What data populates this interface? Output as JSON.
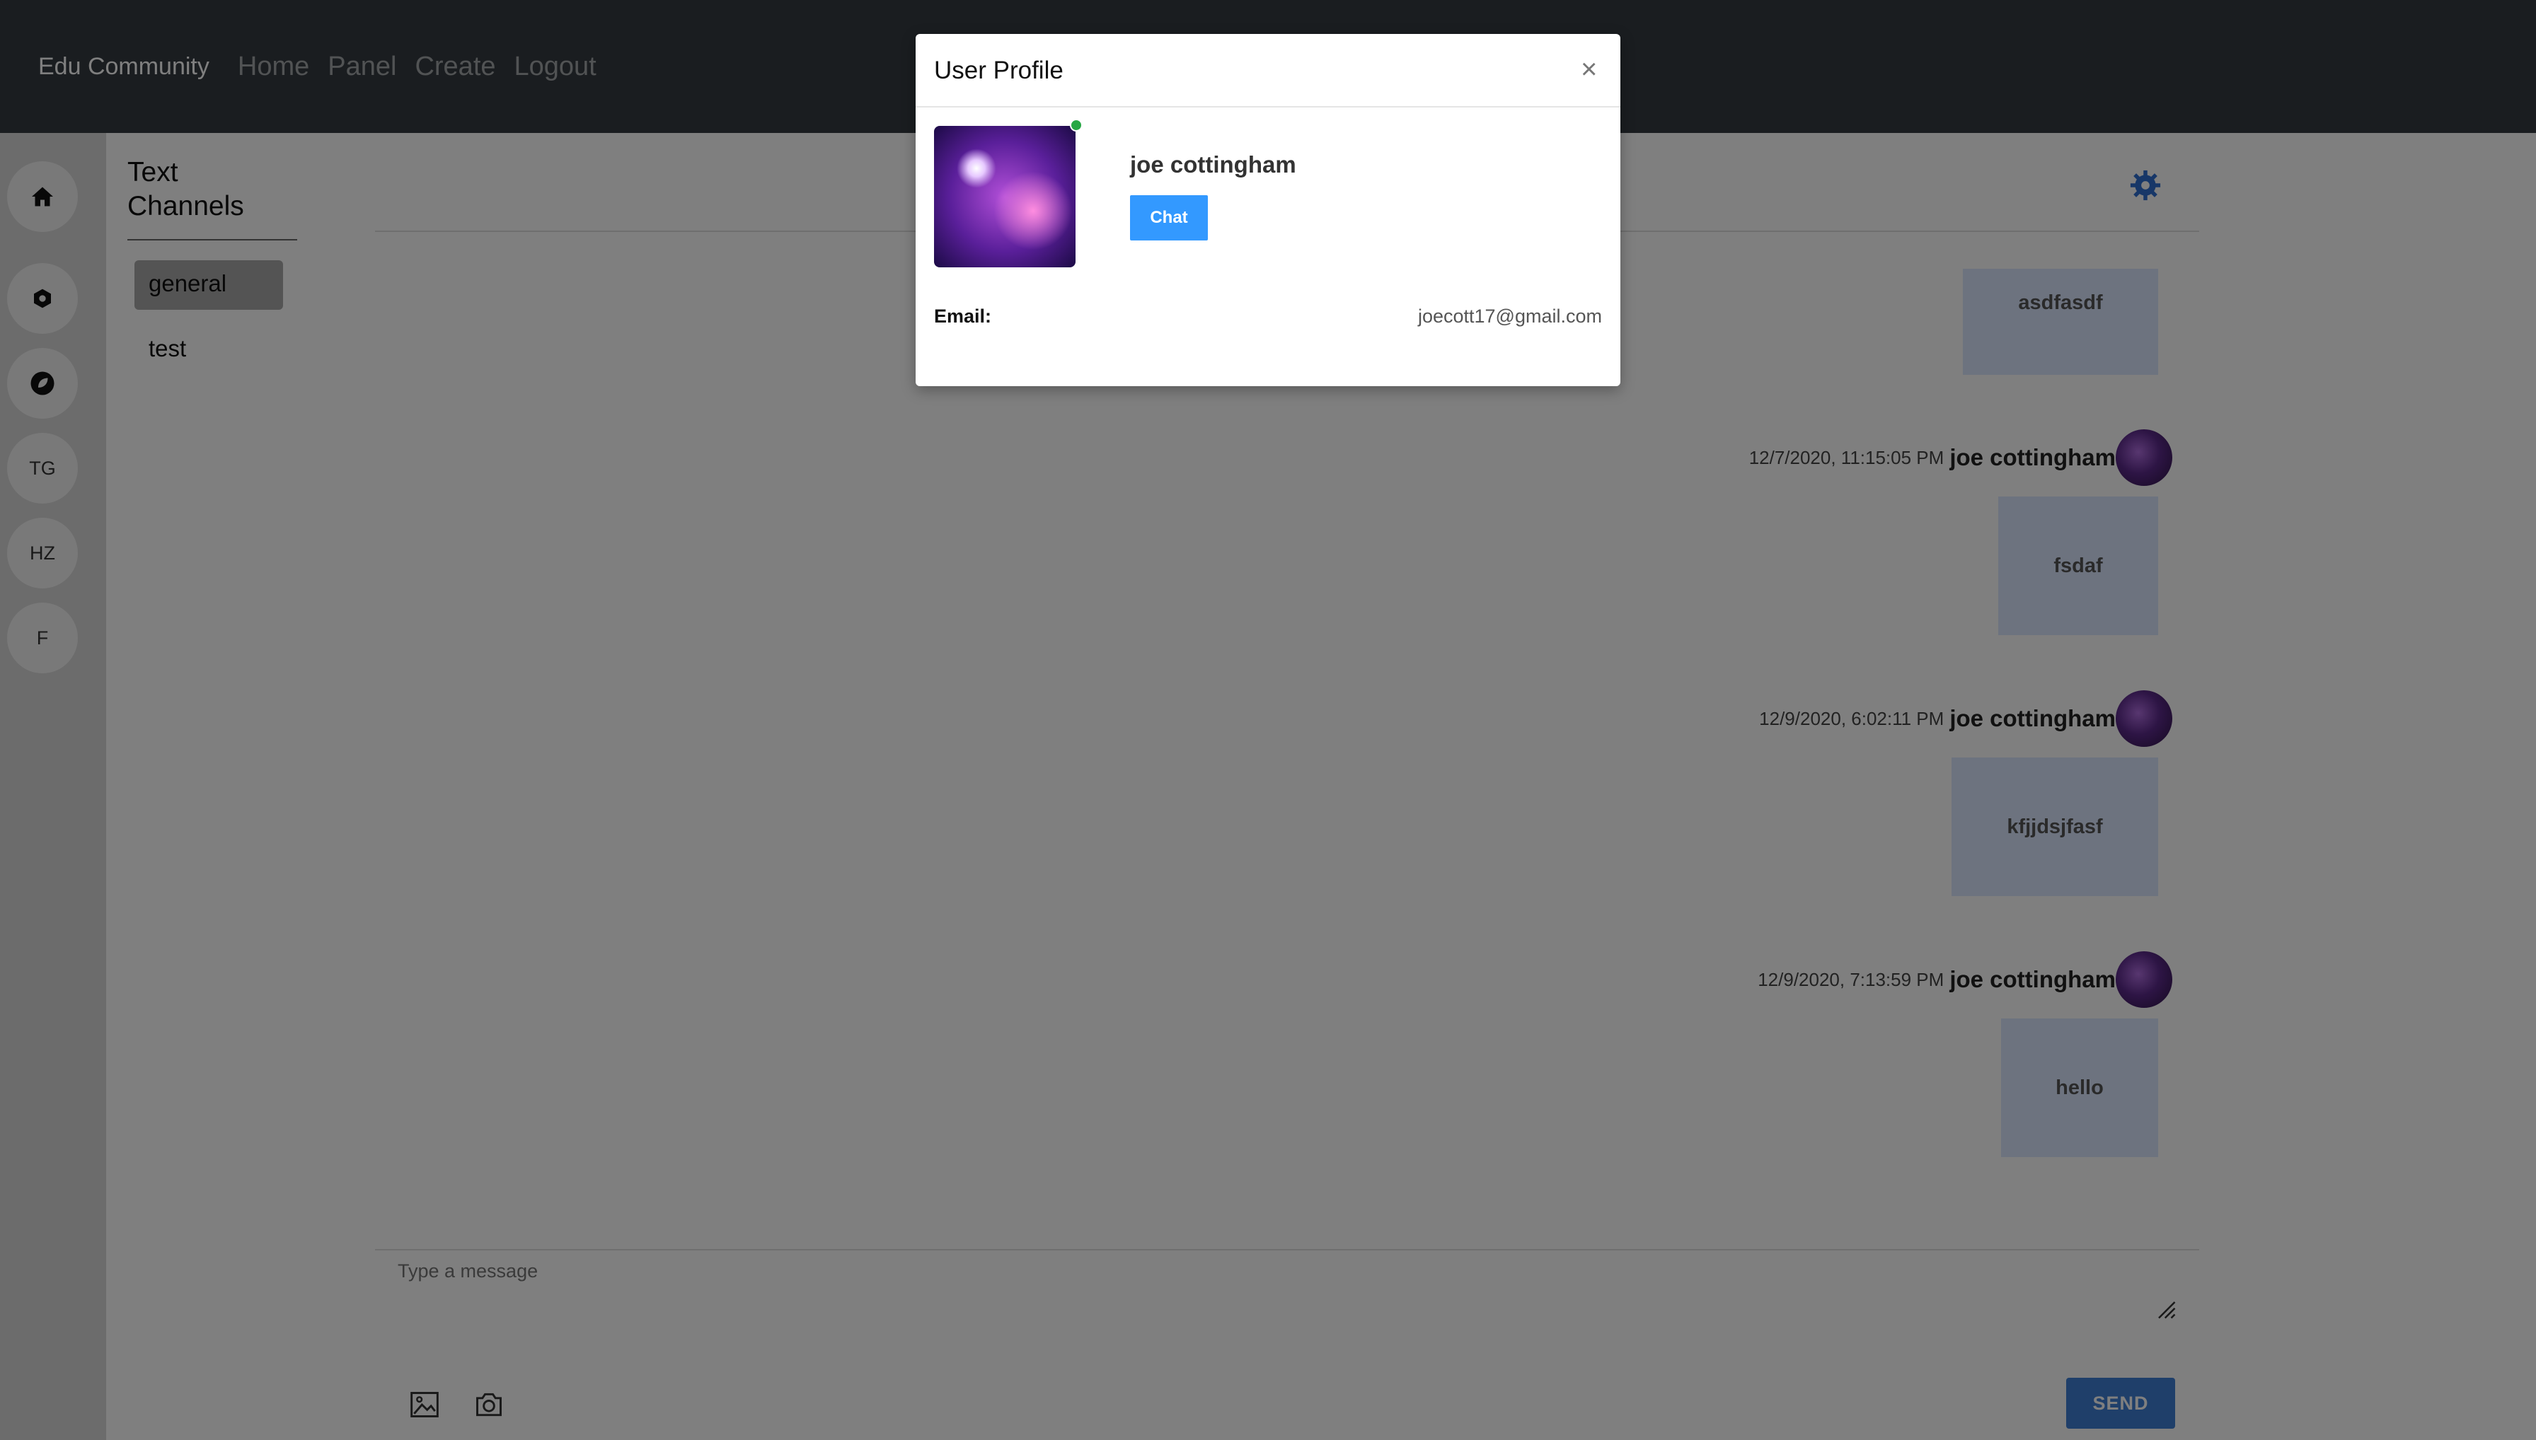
{
  "navbar": {
    "brand": "Edu Community",
    "links": [
      "Home",
      "Panel",
      "Create",
      "Logout"
    ]
  },
  "servers": [
    {
      "icon": "home-icon",
      "label": ""
    },
    {
      "icon": "hexagon-icon",
      "label": ""
    },
    {
      "icon": "leaf-icon",
      "label": ""
    },
    {
      "icon": "",
      "label": "TG"
    },
    {
      "icon": "",
      "label": "HZ"
    },
    {
      "icon": "",
      "label": "F"
    }
  ],
  "channels": {
    "title": "Text Channels",
    "items": [
      {
        "label": "general",
        "active": true
      },
      {
        "label": "test",
        "active": false
      }
    ]
  },
  "messages": [
    {
      "timestamp": "",
      "author": "",
      "text": "asdfasdf"
    },
    {
      "timestamp": "12/7/2020, 11:15:05 PM",
      "author": "joe cottingham",
      "text": "fsdaf"
    },
    {
      "timestamp": "12/9/2020, 6:02:11 PM",
      "author": "joe cottingham",
      "text": "kfjjdsjfasf"
    },
    {
      "timestamp": "12/9/2020, 7:13:59 PM",
      "author": "joe cottingham",
      "text": "hello"
    }
  ],
  "composer": {
    "placeholder": "Type a message",
    "send_label": "SEND"
  },
  "modal": {
    "title": "User Profile",
    "close_glyph": "×",
    "name": "joe cottingham",
    "chat_label": "Chat",
    "email_label": "Email:",
    "email": "joecott17@gmail.com",
    "online": true
  },
  "colors": {
    "navbar": "#343a40",
    "accent": "#3399ff",
    "send": "#3f7fd4",
    "online": "#28a745",
    "bubble": "#dbe6ff"
  }
}
